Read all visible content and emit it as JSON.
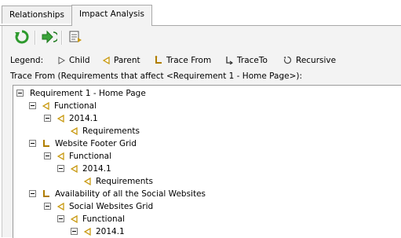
{
  "tabs": [
    {
      "label": "Relationships",
      "active": false
    },
    {
      "label": "Impact Analysis",
      "active": true
    }
  ],
  "toolbar": {
    "refresh_icon": "refresh-icon",
    "go_to_icon": "go-to-requirement-icon",
    "details_icon": "details-icon"
  },
  "legend": {
    "label": "Legend:",
    "items": [
      {
        "icon": "child-icon",
        "label": "Child"
      },
      {
        "icon": "parent-icon",
        "label": "Parent"
      },
      {
        "icon": "trace-from-icon",
        "label": "Trace From"
      },
      {
        "icon": "trace-to-icon",
        "label": "TraceTo"
      },
      {
        "icon": "recursive-icon",
        "label": "Recursive"
      }
    ]
  },
  "trace_from_title": "Trace From (Requirements that affect <Requirement 1 - Home Page>):",
  "colors": {
    "parent_icon": "#c99a12",
    "trace_icon": "#b07d00",
    "refresh_icon": "#2e9a2e"
  },
  "tree": [
    {
      "label": "Requirement 1 - Home Page",
      "level": 0,
      "icon": "none",
      "expander": true
    },
    {
      "label": "Functional",
      "level": 1,
      "icon": "parent",
      "expander": true
    },
    {
      "label": "2014.1",
      "level": 2,
      "icon": "parent",
      "expander": true
    },
    {
      "label": "Requirements",
      "level": 3,
      "icon": "parent",
      "expander": false
    },
    {
      "label": "Website Footer Grid",
      "level": 1,
      "icon": "trace-from",
      "expander": true
    },
    {
      "label": "Functional",
      "level": 2,
      "icon": "parent",
      "expander": true
    },
    {
      "label": "2014.1",
      "level": 3,
      "icon": "parent",
      "expander": true
    },
    {
      "label": "Requirements",
      "level": 4,
      "icon": "parent",
      "expander": false
    },
    {
      "label": "Availability of all the Social Websites",
      "level": 1,
      "icon": "trace-from",
      "expander": true
    },
    {
      "label": "Social Websites Grid",
      "level": 2,
      "icon": "parent",
      "expander": true
    },
    {
      "label": "Functional",
      "level": 3,
      "icon": "parent",
      "expander": true
    },
    {
      "label": "2014.1",
      "level": 4,
      "icon": "parent",
      "expander": true
    }
  ]
}
